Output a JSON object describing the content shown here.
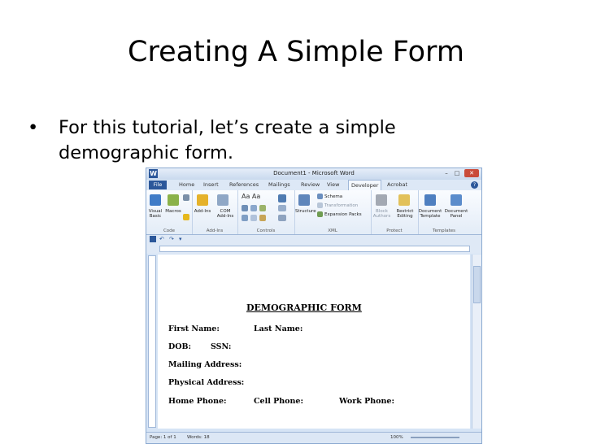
{
  "slide": {
    "title": "Creating A Simple Form",
    "bullet_marker": "•",
    "bullet_text": "For this tutorial, let’s create a simple demographic form."
  },
  "word": {
    "window_title": "Document1 - Microsoft Word",
    "app_icon": "W",
    "window_controls": {
      "minimize": "–",
      "maximize": "□",
      "close": "✕"
    },
    "tabs": [
      "File",
      "Home",
      "Insert",
      "References",
      "Mailings",
      "Review",
      "View",
      "Developer",
      "Acrobat"
    ],
    "active_tab": "Developer",
    "ribbon": {
      "code": {
        "label": "Code",
        "buttons": [
          "Visual Basic",
          "Macros"
        ]
      },
      "addins": {
        "label": "Add-Ins",
        "buttons": [
          "Add-Ins",
          "COM Add-Ins"
        ]
      },
      "controls": {
        "label": "Controls",
        "font_glyphs": "Aa Aa"
      },
      "xml": {
        "label": "XML",
        "structure": "Structure",
        "items": [
          "Schema",
          "Transformation",
          "Expansion Packs"
        ]
      },
      "protect": {
        "label": "Protect",
        "buttons": [
          "Block Authors",
          "Restrict Editing"
        ]
      },
      "templates": {
        "label": "Templates",
        "buttons": [
          "Document Template",
          "Document Panel"
        ]
      }
    },
    "status": {
      "page": "Page: 1 of 1",
      "words": "Words: 18",
      "zoom": "100%"
    },
    "icons": [
      "save-icon",
      "undo-icon",
      "redo-icon",
      "dropdown-icon"
    ]
  },
  "form": {
    "heading": "DEMOGRAPHIC FORM",
    "first_name": "First Name:",
    "last_name": "Last Name:",
    "dob": "DOB:",
    "ssn": "SSN:",
    "mailing_address": "Mailing Address:",
    "physical_address": "Physical Address:",
    "home_phone": "Home Phone:",
    "cell_phone": "Cell Phone:",
    "work_phone": "Work Phone:"
  }
}
